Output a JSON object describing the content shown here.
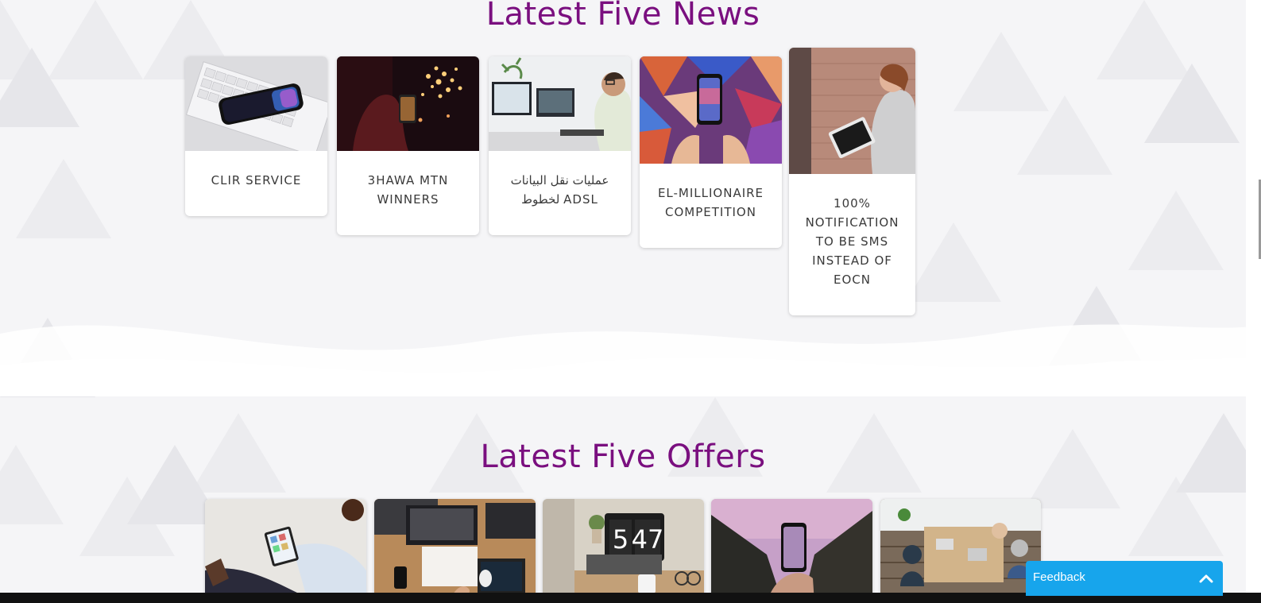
{
  "news": {
    "title": "Latest Five News",
    "items": [
      {
        "label": "CLIR SERVICE",
        "image": "phone-on-keyboard"
      },
      {
        "label": "3HAWA MTN WINNERS",
        "image": "person-with-phone-fireworks"
      },
      {
        "label": "عمليات نقل البيانات لخطوط ADSL",
        "image": "man-at-computer-desk"
      },
      {
        "label": "EL-MILLIONAIRE COMPETITION",
        "image": "hands-holding-phone-mural"
      },
      {
        "label": "100% NOTIFICATION TO BE SMS INSTEAD OF EOCN",
        "image": "woman-with-tablet"
      }
    ]
  },
  "offers": {
    "title": "Latest Five Offers",
    "items": [
      {
        "image": "man-with-tablet"
      },
      {
        "image": "desk-with-laptops"
      },
      {
        "image": "clock-547-laptop"
      },
      {
        "image": "phone-in-canyon"
      },
      {
        "image": "team-meeting"
      }
    ],
    "clock_display": [
      "5",
      "47"
    ]
  },
  "feedback": {
    "label": "Feedback"
  },
  "colors": {
    "accent": "#7a0f7f",
    "feedback_bg": "#17a5ec"
  }
}
